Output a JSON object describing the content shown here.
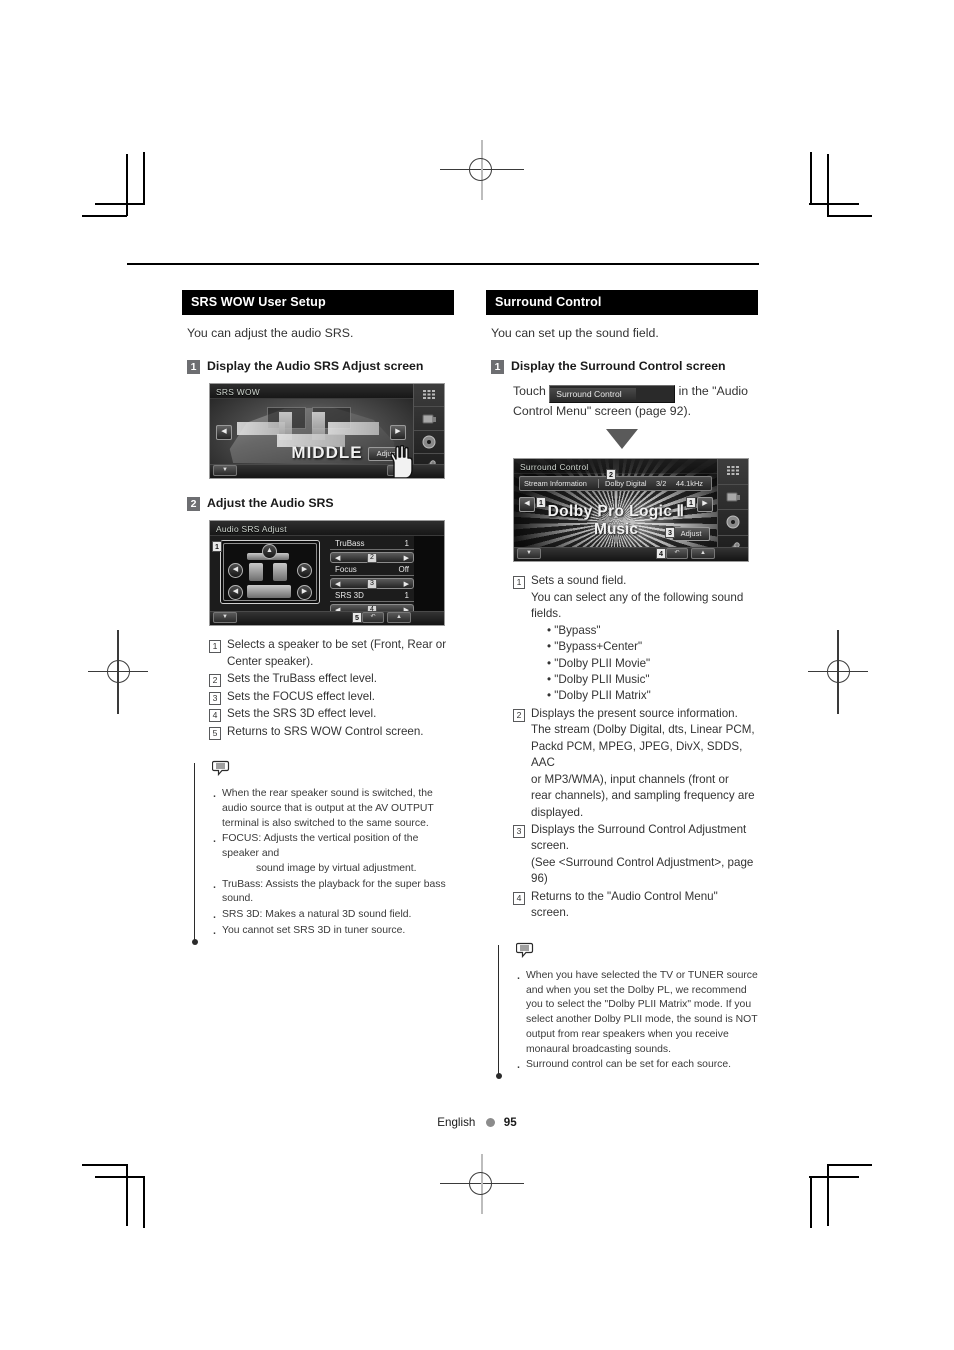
{
  "page": {
    "footer_language": "English",
    "footer_page_number": "95"
  },
  "left_column": {
    "section_title": "SRS WOW User Setup",
    "intro": "You can adjust the audio SRS.",
    "step1": {
      "number": "1",
      "title": "Display the Audio SRS Adjust screen"
    },
    "srs_wow_screen": {
      "title": "SRS WOW",
      "center_label": "MIDDLE",
      "adjust_button": "Adjust",
      "left_arrow": "◀",
      "right_arrow": "▶",
      "bottom_left_button": "▼",
      "bottom_right_button": "▲"
    },
    "step2": {
      "number": "2",
      "title": "Adjust the Audio SRS"
    },
    "srs_adjust_screen": {
      "title": "Audio SRS Adjust",
      "controls": [
        {
          "label": "TruBass",
          "value": "1",
          "callout": "2"
        },
        {
          "label": "Focus",
          "value": "Off",
          "callout": "3"
        },
        {
          "label": "SRS 3D",
          "value": "1",
          "callout": "4"
        }
      ],
      "speaker_box_callout": "1",
      "return_callout": "5",
      "left_arrow": "◀",
      "right_arrow": "▶"
    },
    "descriptions": [
      {
        "n": "1",
        "text": "Selects a speaker to be set (Front, Rear or",
        "cont": "Center speaker)."
      },
      {
        "n": "2",
        "text": "Sets the TruBass effect level."
      },
      {
        "n": "3",
        "text": "Sets the FOCUS effect level."
      },
      {
        "n": "4",
        "text": "Sets the SRS 3D effect level."
      },
      {
        "n": "5",
        "text": "Returns to SRS WOW Control screen."
      }
    ],
    "note_items": [
      "When the rear speaker sound is switched, the audio source that is output at the AV OUTPUT terminal is also switched to the same source.",
      "FOCUS: Adjusts the vertical position of the speaker and",
      "TruBass: Assists the playback for the super bass sound.",
      "SRS 3D: Makes a natural 3D sound field.",
      "You cannot set SRS 3D in tuner source."
    ],
    "note_focus_indent": "sound image by virtual adjustment."
  },
  "right_column": {
    "section_title": "Surround Control",
    "intro": "You can set up the sound field.",
    "step1": {
      "number": "1",
      "title": "Display the Surround Control screen",
      "touch_prefix": "Touch",
      "touch_button": "Surround Control",
      "touch_suffix_line1": "in the \"Audio",
      "touch_suffix_line2": "Control Menu\" screen (page 92)."
    },
    "surround_screen": {
      "title": "Surround Control",
      "stream_label": "Stream Information",
      "stream_format": "Dolby Digital",
      "stream_channels": "3/2",
      "stream_frequency": "44.1kHz",
      "sound_field_line1": "Dolby Pro Logic",
      "sound_field_numeral": "Ⅱ",
      "sound_field_line2": "Music",
      "adjust_button": "Adjust",
      "callouts": {
        "left_arrow": "1",
        "right_arrow": "1",
        "stream": "2",
        "adjust": "3",
        "return": "4"
      },
      "left_arrow": "◀",
      "right_arrow": "▶"
    },
    "descriptions": [
      {
        "n": "1",
        "text": "Sets a sound field.",
        "sub1": "You can select any of the following sound",
        "sub2": "fields.",
        "bullets": [
          "• \"Bypass\"",
          "• \"Bypass+Center\"",
          "• \"Dolby PLII Movie\"",
          "• \"Dolby PLII Music\"",
          "• \"Dolby PLII Matrix\""
        ]
      },
      {
        "n": "2",
        "text": "Displays the present source information.",
        "lines": [
          "The stream (Dolby Digital, dts, Linear PCM,",
          "Packd PCM, MPEG, JPEG, DivX, SDDS, AAC",
          "or MP3/WMA), input channels (front or",
          "rear channels), and sampling frequency are",
          "displayed."
        ]
      },
      {
        "n": "3",
        "text": "Displays the Surround Control Adjustment",
        "lines": [
          "screen.",
          "(See <Surround Control Adjustment>, page",
          "96)"
        ]
      },
      {
        "n": "4",
        "text": "Returns to the \"Audio Control Menu\" screen."
      }
    ],
    "note_items": [
      "When you have selected the TV or TUNER source and when you set the Dolby PL, we recommend you to select the \"Dolby PLII Matrix\" mode. If you select another Dolby PLII mode, the sound is NOT output from rear speakers when you receive monaural broadcasting sounds.",
      "Surround control can be set for each source."
    ]
  }
}
